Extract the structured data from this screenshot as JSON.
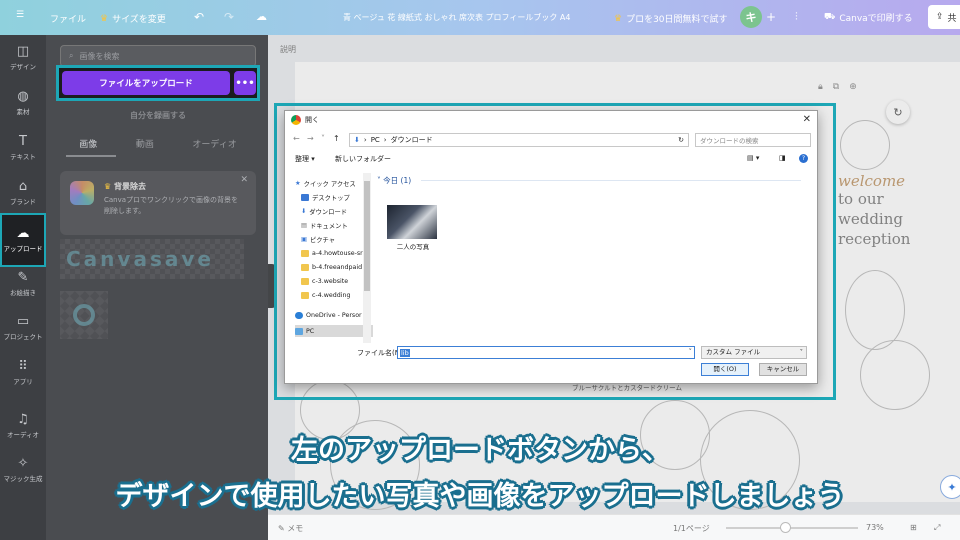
{
  "topbar": {
    "menu_icon": "hamburger-icon",
    "file_label": "ファイル",
    "resize_label": "サイズを変更",
    "doc_title": "青 ベージュ 花 線紙式 おしゃれ 席次表 プロフィールブック A4",
    "pro_trial": "プロを30日間無料で試す",
    "avatar_letter": "キ",
    "print_label": "Canvaで印刷する",
    "share_label": "共"
  },
  "rail": {
    "items": [
      {
        "label": "デザイン",
        "icon": "layout-icon"
      },
      {
        "label": "素材",
        "icon": "shapes-icon"
      },
      {
        "label": "テキスト",
        "icon": "text-icon"
      },
      {
        "label": "ブランド",
        "icon": "brand-icon"
      },
      {
        "label": "アップロード",
        "icon": "cloud-upload-icon"
      },
      {
        "label": "お絵描き",
        "icon": "draw-icon"
      },
      {
        "label": "プロジェクト",
        "icon": "folder-icon"
      },
      {
        "label": "アプリ",
        "icon": "apps-icon"
      },
      {
        "label": "オーディオ",
        "icon": "music-icon"
      },
      {
        "label": "マジック生成",
        "icon": "magic-icon"
      }
    ]
  },
  "panel": {
    "search_placeholder": "画像を検索",
    "upload_label": "ファイルをアップロード",
    "more_label": "•••",
    "record_label": "自分を録画する",
    "tabs": [
      "画像",
      "動画",
      "オーディオ"
    ],
    "promo_title": "背景除去",
    "promo_text": "Canvaプロでワンクリックで画像の背景を削除します。",
    "thumb_text": "Canvasave"
  },
  "canvas": {
    "memo_top": "説明",
    "deco_words": [
      "welcome",
      "to our",
      "wedding",
      "reception"
    ],
    "bottom_note": "ブルーサクルトとカスタードクリーム",
    "bottom_memo": "メモ",
    "page_count": "1/1ページ",
    "zoom": "73%",
    "zoom_fraction": 0.45
  },
  "dialog": {
    "title": "開く",
    "path": [
      "PC",
      "ダウンロード"
    ],
    "search_placeholder": "ダウンロードの検索",
    "organize": "整理 ▾",
    "new_folder": "新しいフォルダー",
    "group_header": "今日 (1)",
    "nav_items": [
      {
        "label": "クイック アクセス",
        "icon": "star",
        "pinned": false
      },
      {
        "label": "デスクトップ",
        "icon": "blue",
        "pinned": true
      },
      {
        "label": "ダウンロード",
        "icon": "download",
        "pinned": true
      },
      {
        "label": "ドキュメント",
        "icon": "doc",
        "pinned": true
      },
      {
        "label": "ピクチャ",
        "icon": "pic",
        "pinned": true
      },
      {
        "label": "a-4.howtouse-sr",
        "icon": "folder",
        "pinned": false
      },
      {
        "label": "b-4.freeandpaid",
        "icon": "folder",
        "pinned": false
      },
      {
        "label": "c-3.website",
        "icon": "folder",
        "pinned": false
      },
      {
        "label": "c-4.wedding",
        "icon": "folder",
        "pinned": false
      },
      {
        "label": "OneDrive - Persor",
        "icon": "cloud",
        "pinned": false
      },
      {
        "label": "PC",
        "icon": "pc",
        "pinned": false
      }
    ],
    "file_name": "二人の写真",
    "filename_label": "ファイル名(N):",
    "filename_value": "lib",
    "filetype_value": "カスタム ファイル",
    "open_button": "開く(O)",
    "cancel_button": "キャンセル"
  },
  "caption": {
    "line1": "左のアップロードボタンから、",
    "line2": "デザインで使用したい写真や画像をアップロードしましょう"
  },
  "colors": {
    "accent_cyan": "#1da7b6",
    "upload_purple": "#7d3ce8",
    "caption_outline": "#1a6f8f"
  }
}
